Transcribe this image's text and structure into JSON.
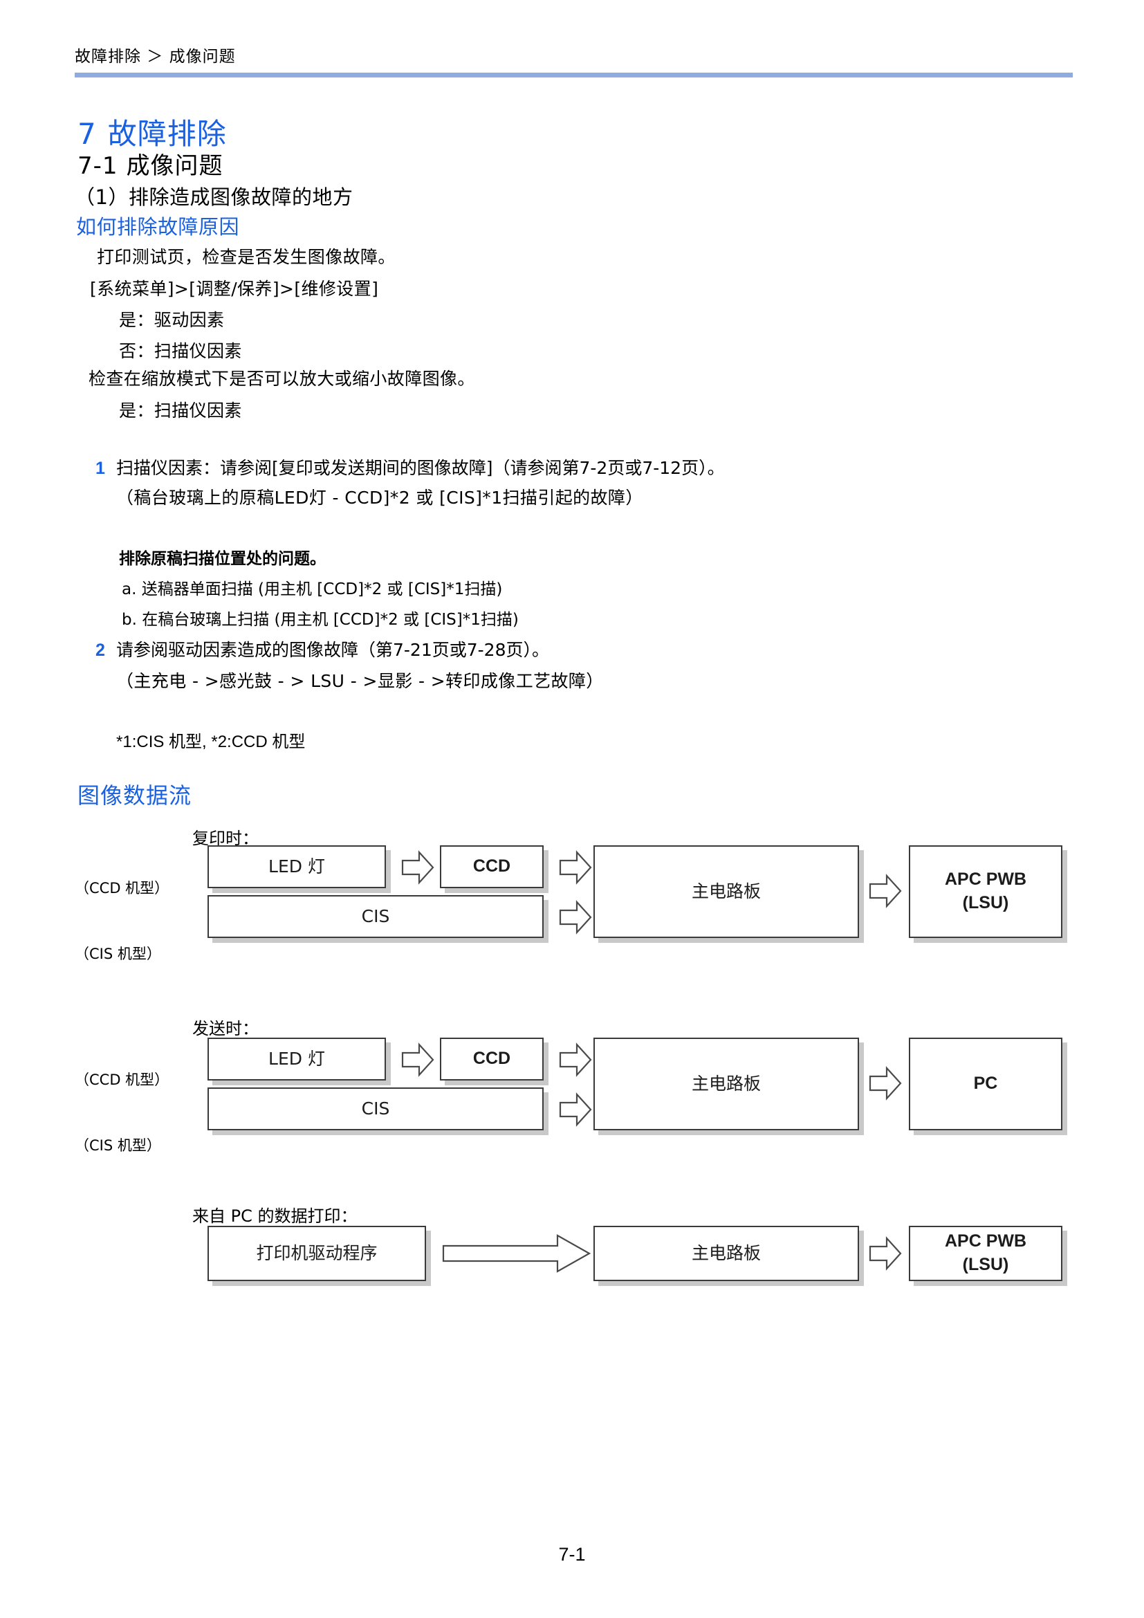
{
  "header": {
    "breadcrumb": "故障排除 ＞ 成像问题",
    "rule_color": "#8fabe0"
  },
  "headings": {
    "chapter_number": "7",
    "chapter_title": "故障排除",
    "section_number": "7-1",
    "section_title": "成像问题",
    "subsection": "（1）排除造成图像故障的地方",
    "blue_subhead": "如何排除故障原因",
    "data_flow_heading": "图像数据流",
    "accent_color": "#1a61e0"
  },
  "body": {
    "line1": "打印测试页，检查是否发生图像故障。",
    "line2": "[系统菜单]>[调整/保养]>[维修设置]",
    "line3": "是：驱动因素",
    "line4": "否：扫描仪因素",
    "line5": "检查在缩放模式下是否可以放大或缩小故障图像。",
    "line6": "是：扫描仪因素"
  },
  "numbered": [
    {
      "marker": "1",
      "text": "扫描仪因素：请参阅[复印或发送期间的图像故障]（请参阅第7-2页或7-12页）。",
      "sub": "（稿台玻璃上的原稿LED灯 - CCD]*2 或 [CIS]*1扫描引起的故障）"
    },
    {
      "marker": "2",
      "text": "请参阅驱动因素造成的图像故障（第7-21页或7-28页）。",
      "sub": "（主充电 - >感光鼓 - > LSU - >显影 - >转印成像工艺故障）"
    }
  ],
  "scan_block": {
    "bold_title": "排除原稿扫描位置处的问题。",
    "item_a": "a. 送稿器单面扫描 (用主机 [CCD]*2 或 [CIS]*1扫描)",
    "item_b": "b. 在稿台玻璃上扫描 (用主机 [CCD]*2 或 [CIS]*1扫描)"
  },
  "footnote": "*1:CIS 机型, *2:CCD 机型",
  "diagram": {
    "flow1": {
      "caption": "复印时：",
      "row_label_ccd": "（CCD 机型）",
      "row_label_cis": "（CIS 机型）",
      "box_led": "LED 灯",
      "box_ccd": "CCD",
      "box_cis": "CIS",
      "box_main": "主电路板",
      "box_apc_line1": "APC PWB",
      "box_apc_line2": "(LSU)"
    },
    "flow2": {
      "caption": "发送时：",
      "row_label_ccd": "（CCD 机型）",
      "row_label_cis": "（CIS 机型）",
      "box_led": "LED 灯",
      "box_ccd": "CCD",
      "box_cis": "CIS",
      "box_main": "主电路板",
      "box_pc": "PC"
    },
    "flow3": {
      "caption": "来自 PC 的数据打印：",
      "box_driver": "打印机驱动程序",
      "box_main": "主电路板",
      "box_apc_line1": "APC PWB",
      "box_apc_line2": "(LSU)"
    }
  },
  "footer": {
    "page_number": "7-1"
  }
}
